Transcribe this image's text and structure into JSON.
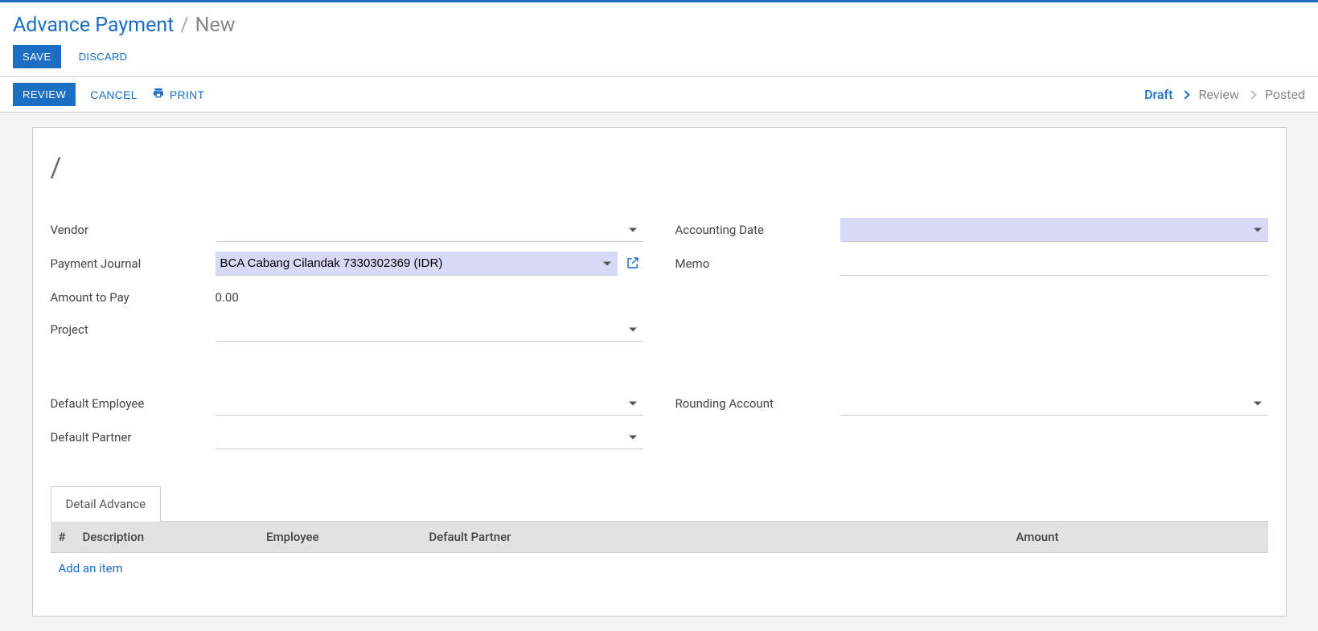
{
  "breadcrumb": {
    "title": "Advance Payment",
    "current": "New",
    "sep": "/"
  },
  "buttons": {
    "save": "SAVE",
    "discard": "DISCARD",
    "review": "REVIEW",
    "cancel": "CANCEL",
    "print": "PRINT"
  },
  "status": {
    "draft": "Draft",
    "review": "Review",
    "posted": "Posted"
  },
  "record_name": "/",
  "fields": {
    "vendor": {
      "label": "Vendor",
      "value": ""
    },
    "payment_journal": {
      "label": "Payment Journal",
      "value": "BCA Cabang Cilandak 7330302369 (IDR)"
    },
    "amount_to_pay": {
      "label": "Amount to Pay",
      "value": "0.00"
    },
    "project": {
      "label": "Project",
      "value": ""
    },
    "accounting_date": {
      "label": "Accounting Date",
      "value": ""
    },
    "memo": {
      "label": "Memo",
      "value": ""
    },
    "default_employee": {
      "label": "Default Employee",
      "value": ""
    },
    "default_partner": {
      "label": "Default Partner",
      "value": ""
    },
    "rounding_account": {
      "label": "Rounding Account",
      "value": ""
    }
  },
  "tab": {
    "detail_advance": "Detail Advance"
  },
  "table": {
    "headers": {
      "num": "#",
      "description": "Description",
      "employee": "Employee",
      "default_partner": "Default Partner",
      "amount": "Amount"
    },
    "add_item": "Add an item"
  }
}
